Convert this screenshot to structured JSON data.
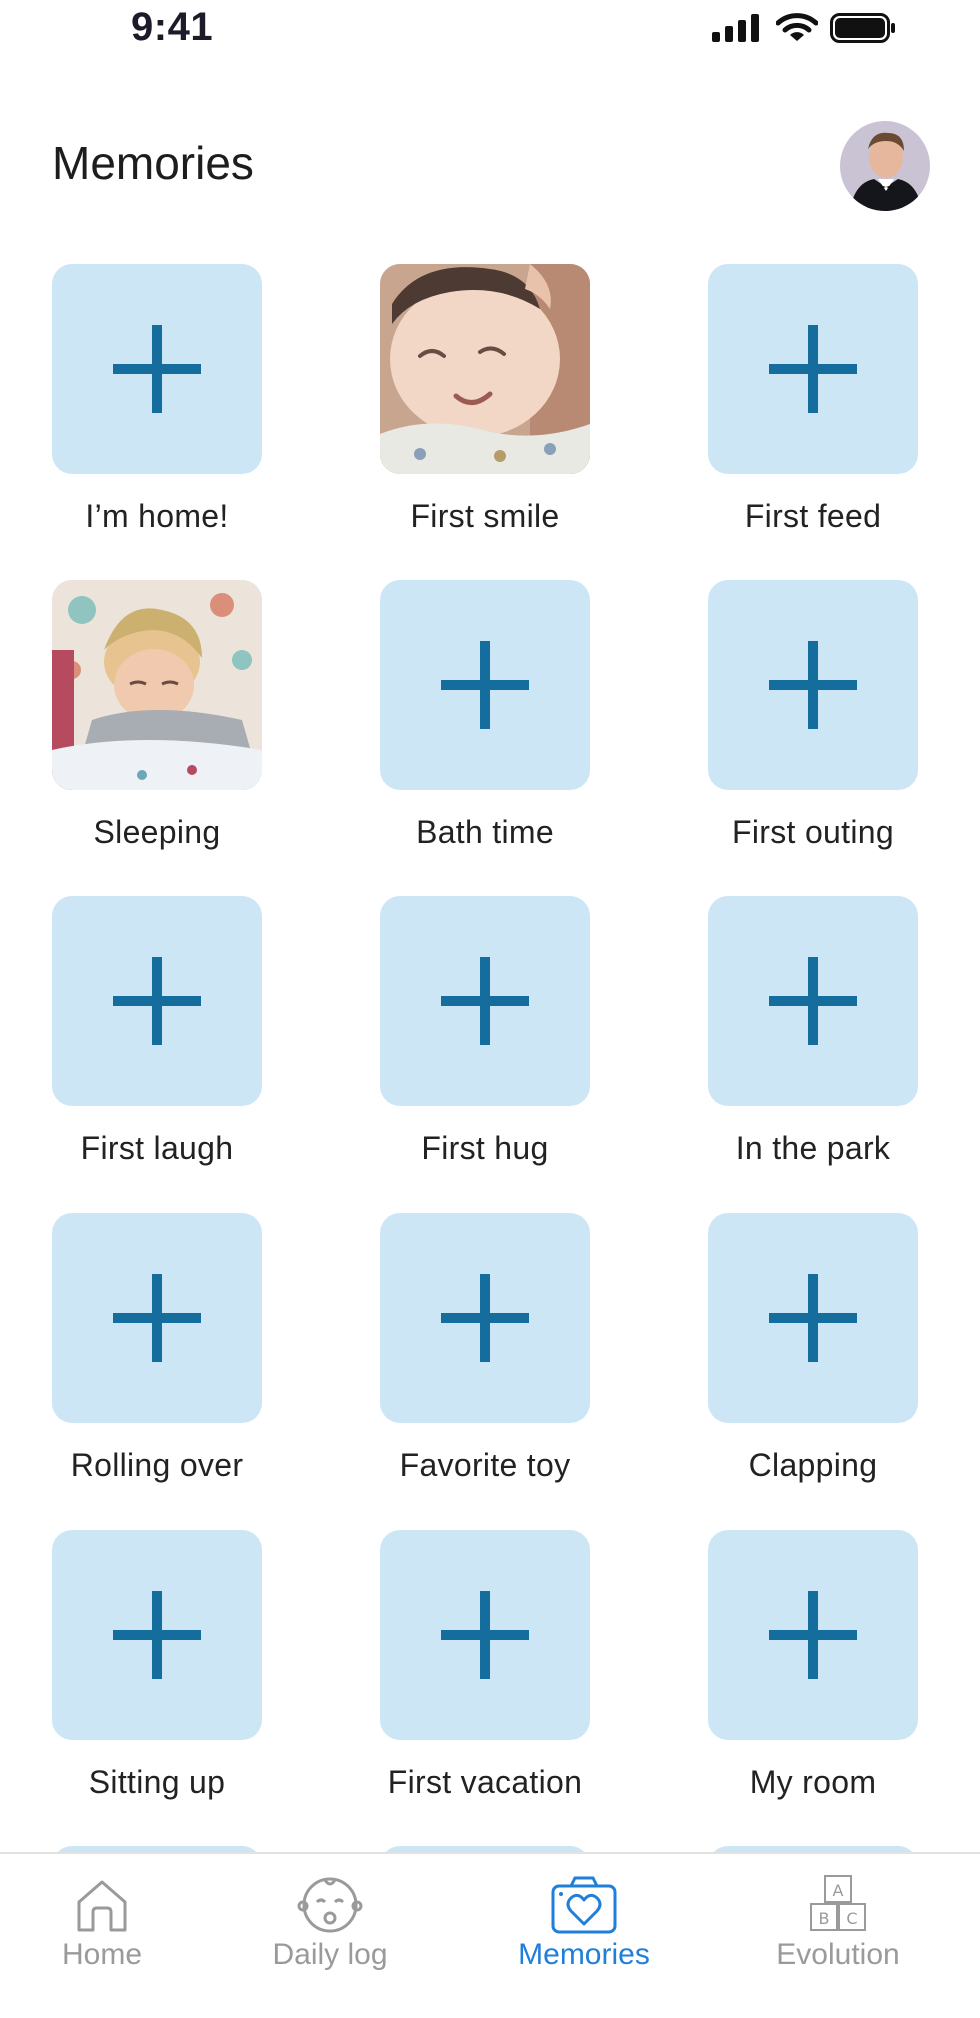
{
  "status_bar": {
    "time": "9:41"
  },
  "header": {
    "title": "Memories"
  },
  "colors": {
    "tile_bg": "#cde6f6",
    "plus": "#156d9e",
    "nav_active": "#1f7fd9",
    "nav_inactive": "#9a9a9a"
  },
  "memories": [
    {
      "label": "I’m home!",
      "state": "empty"
    },
    {
      "label": "First smile",
      "state": "photo"
    },
    {
      "label": "First feed",
      "state": "empty"
    },
    {
      "label": "Sleeping",
      "state": "photo"
    },
    {
      "label": "Bath time",
      "state": "empty"
    },
    {
      "label": "First outing",
      "state": "empty"
    },
    {
      "label": "First laugh",
      "state": "empty"
    },
    {
      "label": "First hug",
      "state": "empty"
    },
    {
      "label": "In the park",
      "state": "empty"
    },
    {
      "label": "Rolling over",
      "state": "empty"
    },
    {
      "label": "Favorite toy",
      "state": "empty"
    },
    {
      "label": "Clapping",
      "state": "empty"
    },
    {
      "label": "Sitting up",
      "state": "empty"
    },
    {
      "label": "First vacation",
      "state": "empty"
    },
    {
      "label": "My room",
      "state": "empty"
    }
  ],
  "bottom_nav": {
    "items": [
      {
        "label": "Home",
        "icon": "home-icon",
        "active": false
      },
      {
        "label": "Daily log",
        "icon": "baby-face-icon",
        "active": false
      },
      {
        "label": "Memories",
        "icon": "camera-heart-icon",
        "active": true
      },
      {
        "label": "Evolution",
        "icon": "abc-blocks-icon",
        "active": false
      }
    ]
  }
}
